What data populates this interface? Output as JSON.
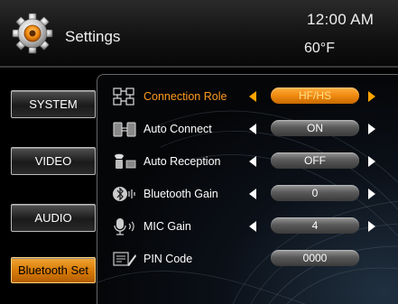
{
  "header": {
    "title": "Settings",
    "time": "12:00  AM",
    "temperature": "60°F"
  },
  "nav": {
    "items": [
      {
        "label": "SYSTEM",
        "active": false
      },
      {
        "label": "VIDEO",
        "active": false
      },
      {
        "label": "AUDIO",
        "active": false
      },
      {
        "label": "Bluetooth Set",
        "active": true
      }
    ]
  },
  "settings": {
    "rows": [
      {
        "icon": "connection-role-icon",
        "label": "Connection Role",
        "value": "HF/HS",
        "selected": true
      },
      {
        "icon": "auto-connect-icon",
        "label": "Auto Connect",
        "value": "ON",
        "selected": false
      },
      {
        "icon": "auto-reception-icon",
        "label": "Auto Reception",
        "value": "OFF",
        "selected": false
      },
      {
        "icon": "bluetooth-gain-icon",
        "label": "Bluetooth Gain",
        "value": "0",
        "selected": false
      },
      {
        "icon": "mic-gain-icon",
        "label": "MIC Gain",
        "value": "4",
        "selected": false
      },
      {
        "icon": "pin-code-icon",
        "label": "PIN Code",
        "value": "0000",
        "selected": false
      }
    ]
  },
  "colors": {
    "accent": "#ffa500",
    "selected_label": "#ff9a1e"
  }
}
